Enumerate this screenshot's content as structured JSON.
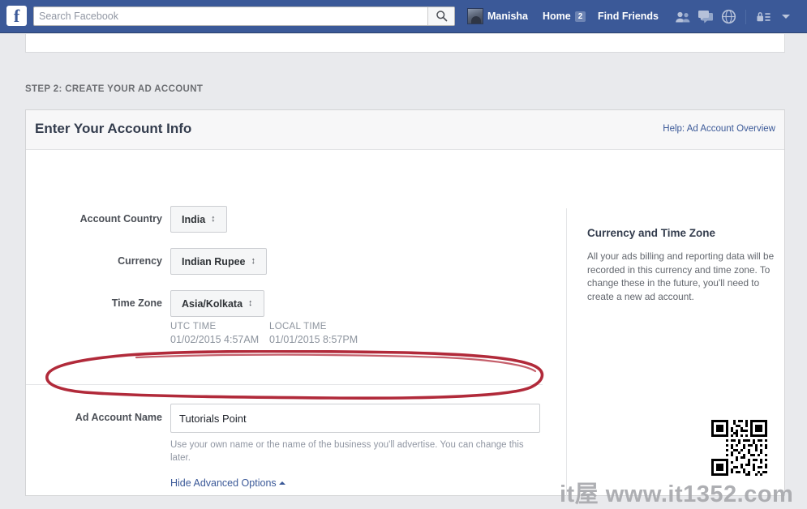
{
  "navbar": {
    "logo": "f",
    "search": {
      "placeholder": "Search Facebook",
      "value": "",
      "icon": "search-icon"
    },
    "profile_name": "Manisha",
    "home_label": "Home",
    "home_badge": "2",
    "find_friends_label": "Find Friends",
    "icons": [
      "friend-requests-icon",
      "messages-icon",
      "notifications-globe-icon",
      "privacy-lock-icon",
      "account-dropdown-caret-icon"
    ],
    "background_color": "#3b5998"
  },
  "page": {
    "step_label": "STEP 2: CREATE YOUR AD ACCOUNT",
    "background_color": "#e9eaed"
  },
  "card": {
    "title": "Enter Your Account Info",
    "help_link": "Help: Ad Account Overview"
  },
  "form": {
    "rows": [
      {
        "label": "Account Country",
        "value": "India",
        "control": "select"
      },
      {
        "label": "Currency",
        "value": "Indian Rupee",
        "control": "select"
      },
      {
        "label": "Time Zone",
        "value": "Asia/Kolkata",
        "control": "select"
      }
    ],
    "select_arrow_glyph": "↕",
    "times": {
      "utc_heading": "UTC TIME",
      "utc_value": "01/02/2015 4:57AM",
      "local_heading": "LOCAL TIME",
      "local_value": "01/01/2015 8:57PM"
    },
    "account_name": {
      "label": "Ad Account Name",
      "value": "Tutorials Point",
      "placeholder": "",
      "hint": "Use your own name or the name of the business you'll advertise. You can change this later."
    },
    "advanced_toggle_label": "Hide Advanced Options"
  },
  "sidebar": {
    "title": "Currency and Time Zone",
    "body": "All your ads billing and reporting data will be recorded in this currency and time zone. To change these in the future, you'll need to create a new ad account."
  },
  "annotation": {
    "shape": "hand-drawn-ellipse",
    "color": "#b12a3a",
    "target": "Ad Account Name field"
  },
  "watermark": {
    "text": "it屋 www.it1352.com",
    "color": "#a8a9ad",
    "qr_label": "qr-code"
  }
}
